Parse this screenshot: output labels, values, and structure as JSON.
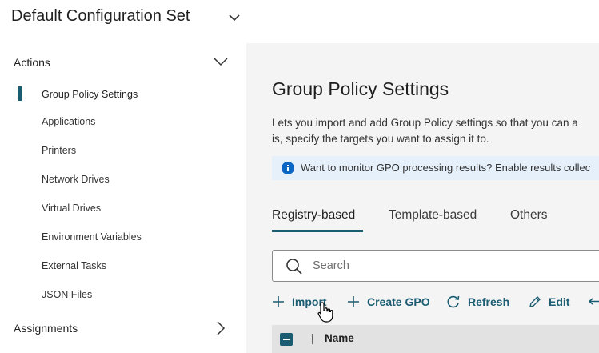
{
  "header": {
    "title": "Default Configuration Set"
  },
  "sidebar": {
    "actions_label": "Actions",
    "items": [
      {
        "label": "Group Policy Settings",
        "active": true
      },
      {
        "label": "Applications"
      },
      {
        "label": "Printers"
      },
      {
        "label": "Network Drives"
      },
      {
        "label": "Virtual Drives"
      },
      {
        "label": "Environment Variables"
      },
      {
        "label": "External Tasks"
      },
      {
        "label": "JSON Files"
      }
    ],
    "assignments_label": "Assignments"
  },
  "main": {
    "title": "Group Policy Settings",
    "description_line1": "Lets you import and add Group Policy settings so that you can a",
    "description_line2": "is, specify the targets you want to assign it to.",
    "banner_text": "Want to monitor GPO processing results? Enable results collec",
    "tabs": [
      {
        "label": "Registry-based",
        "active": true
      },
      {
        "label": "Template-based"
      },
      {
        "label": "Others"
      }
    ],
    "search": {
      "placeholder": "Search"
    },
    "toolbar": {
      "import_label": "Import",
      "create_label": "Create GPO",
      "refresh_label": "Refresh",
      "edit_label": "Edit"
    },
    "table": {
      "name_header": "Name"
    }
  },
  "colors": {
    "accent": "#1a5c72",
    "info": "#0a66c2",
    "main_bg": "#f4f4f4"
  },
  "icons": [
    "chevron-down-icon",
    "chevron-right-icon",
    "info-icon",
    "search-icon",
    "plus-icon",
    "refresh-icon",
    "pencil-icon",
    "hand-cursor-icon"
  ]
}
